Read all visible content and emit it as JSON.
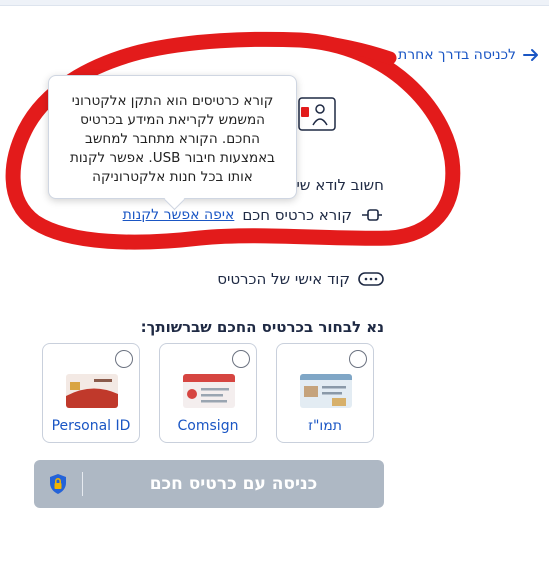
{
  "alt_login": {
    "label": "לכניסה בדרך אחרת"
  },
  "tooltip": {
    "text": "קורא כרטיסים הוא התקן אלקטרוני המשמש לקריאת המידע בכרטיס החכם. הקורא מתחבר למחשב באמצעות חיבור USB. אפשר לקנות אותו בכל חנות אלקטרוניקה"
  },
  "requirements": {
    "title": "חשוב לודא שי",
    "reader": {
      "label": "קורא כרטיס חכם",
      "link": "איפה אפשר לקנות"
    },
    "pin": {
      "label": "קוד אישי של הכרטיס"
    }
  },
  "choose_card": {
    "label": "נא לבחור בכרטיס החכם שברשותך:",
    "options": [
      {
        "label": "Personal ID"
      },
      {
        "label": "Comsign"
      },
      {
        "label": "תמו\"ז"
      }
    ]
  },
  "login_button": {
    "label": "כניסה עם כרטיס חכם",
    "state": "disabled"
  },
  "colors": {
    "accent": "#1a56c4",
    "annotation": "#e31b1b",
    "button_disabled": "#aeb8c4"
  }
}
